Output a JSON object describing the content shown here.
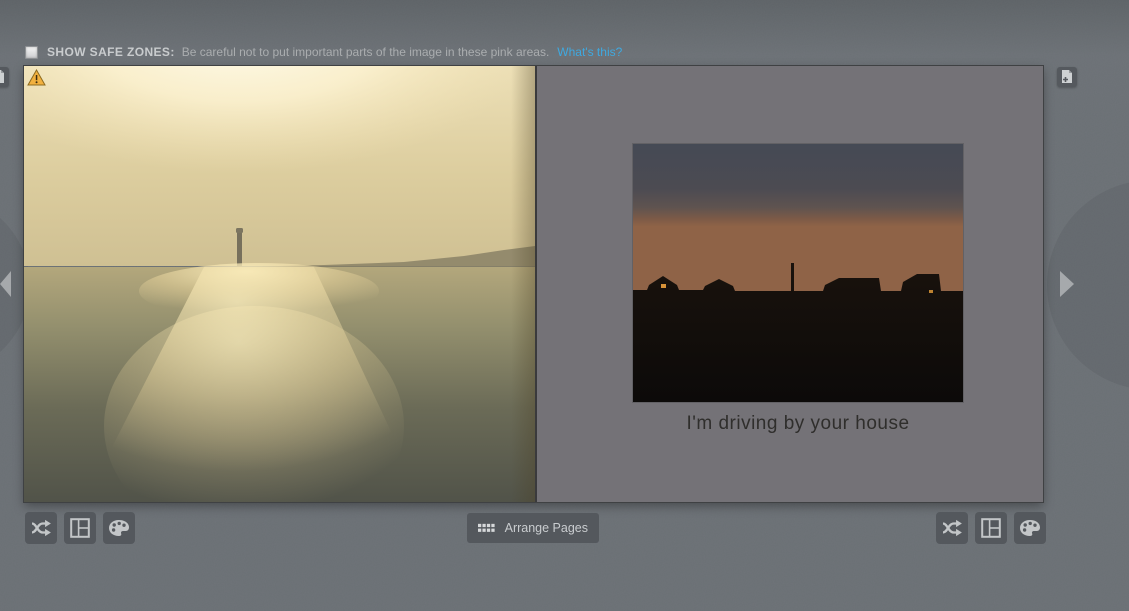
{
  "safe_zones": {
    "checkbox_checked": false,
    "label": "SHOW SAFE ZONES:",
    "description": "Be careful not to put important parts of the image in these pink areas.",
    "link_label": "What's this?"
  },
  "spread": {
    "left_page": {
      "photo": "hazy sunset over ocean with lighthouse on coastline, sun glare reflecting on water",
      "warning_icon": "warning-icon"
    },
    "right_page": {
      "photo": "dusk sky fading to orange over silhouetted beach houses",
      "caption": "I'm driving by your house"
    }
  },
  "navigation": {
    "prev_icon": "chevron-left-icon",
    "next_icon": "chevron-right-icon",
    "add_page_left_icon": "add-page-icon",
    "add_page_right_icon": "add-page-icon"
  },
  "toolbar": {
    "arrange_pages_label": "Arrange Pages",
    "left_buttons": [
      "shuffle-icon",
      "layout-icon",
      "palette-icon"
    ],
    "right_buttons": [
      "shuffle-icon",
      "layout-icon",
      "palette-icon"
    ]
  },
  "colors": {
    "background": "#6b7075",
    "page_gray": "#747277",
    "toolbar_button": "#54585d",
    "link_blue": "#3fa9e0",
    "caption_text": "#2f2e2c",
    "bar_label": "#c9ccce",
    "bar_text": "#aaadaf"
  }
}
